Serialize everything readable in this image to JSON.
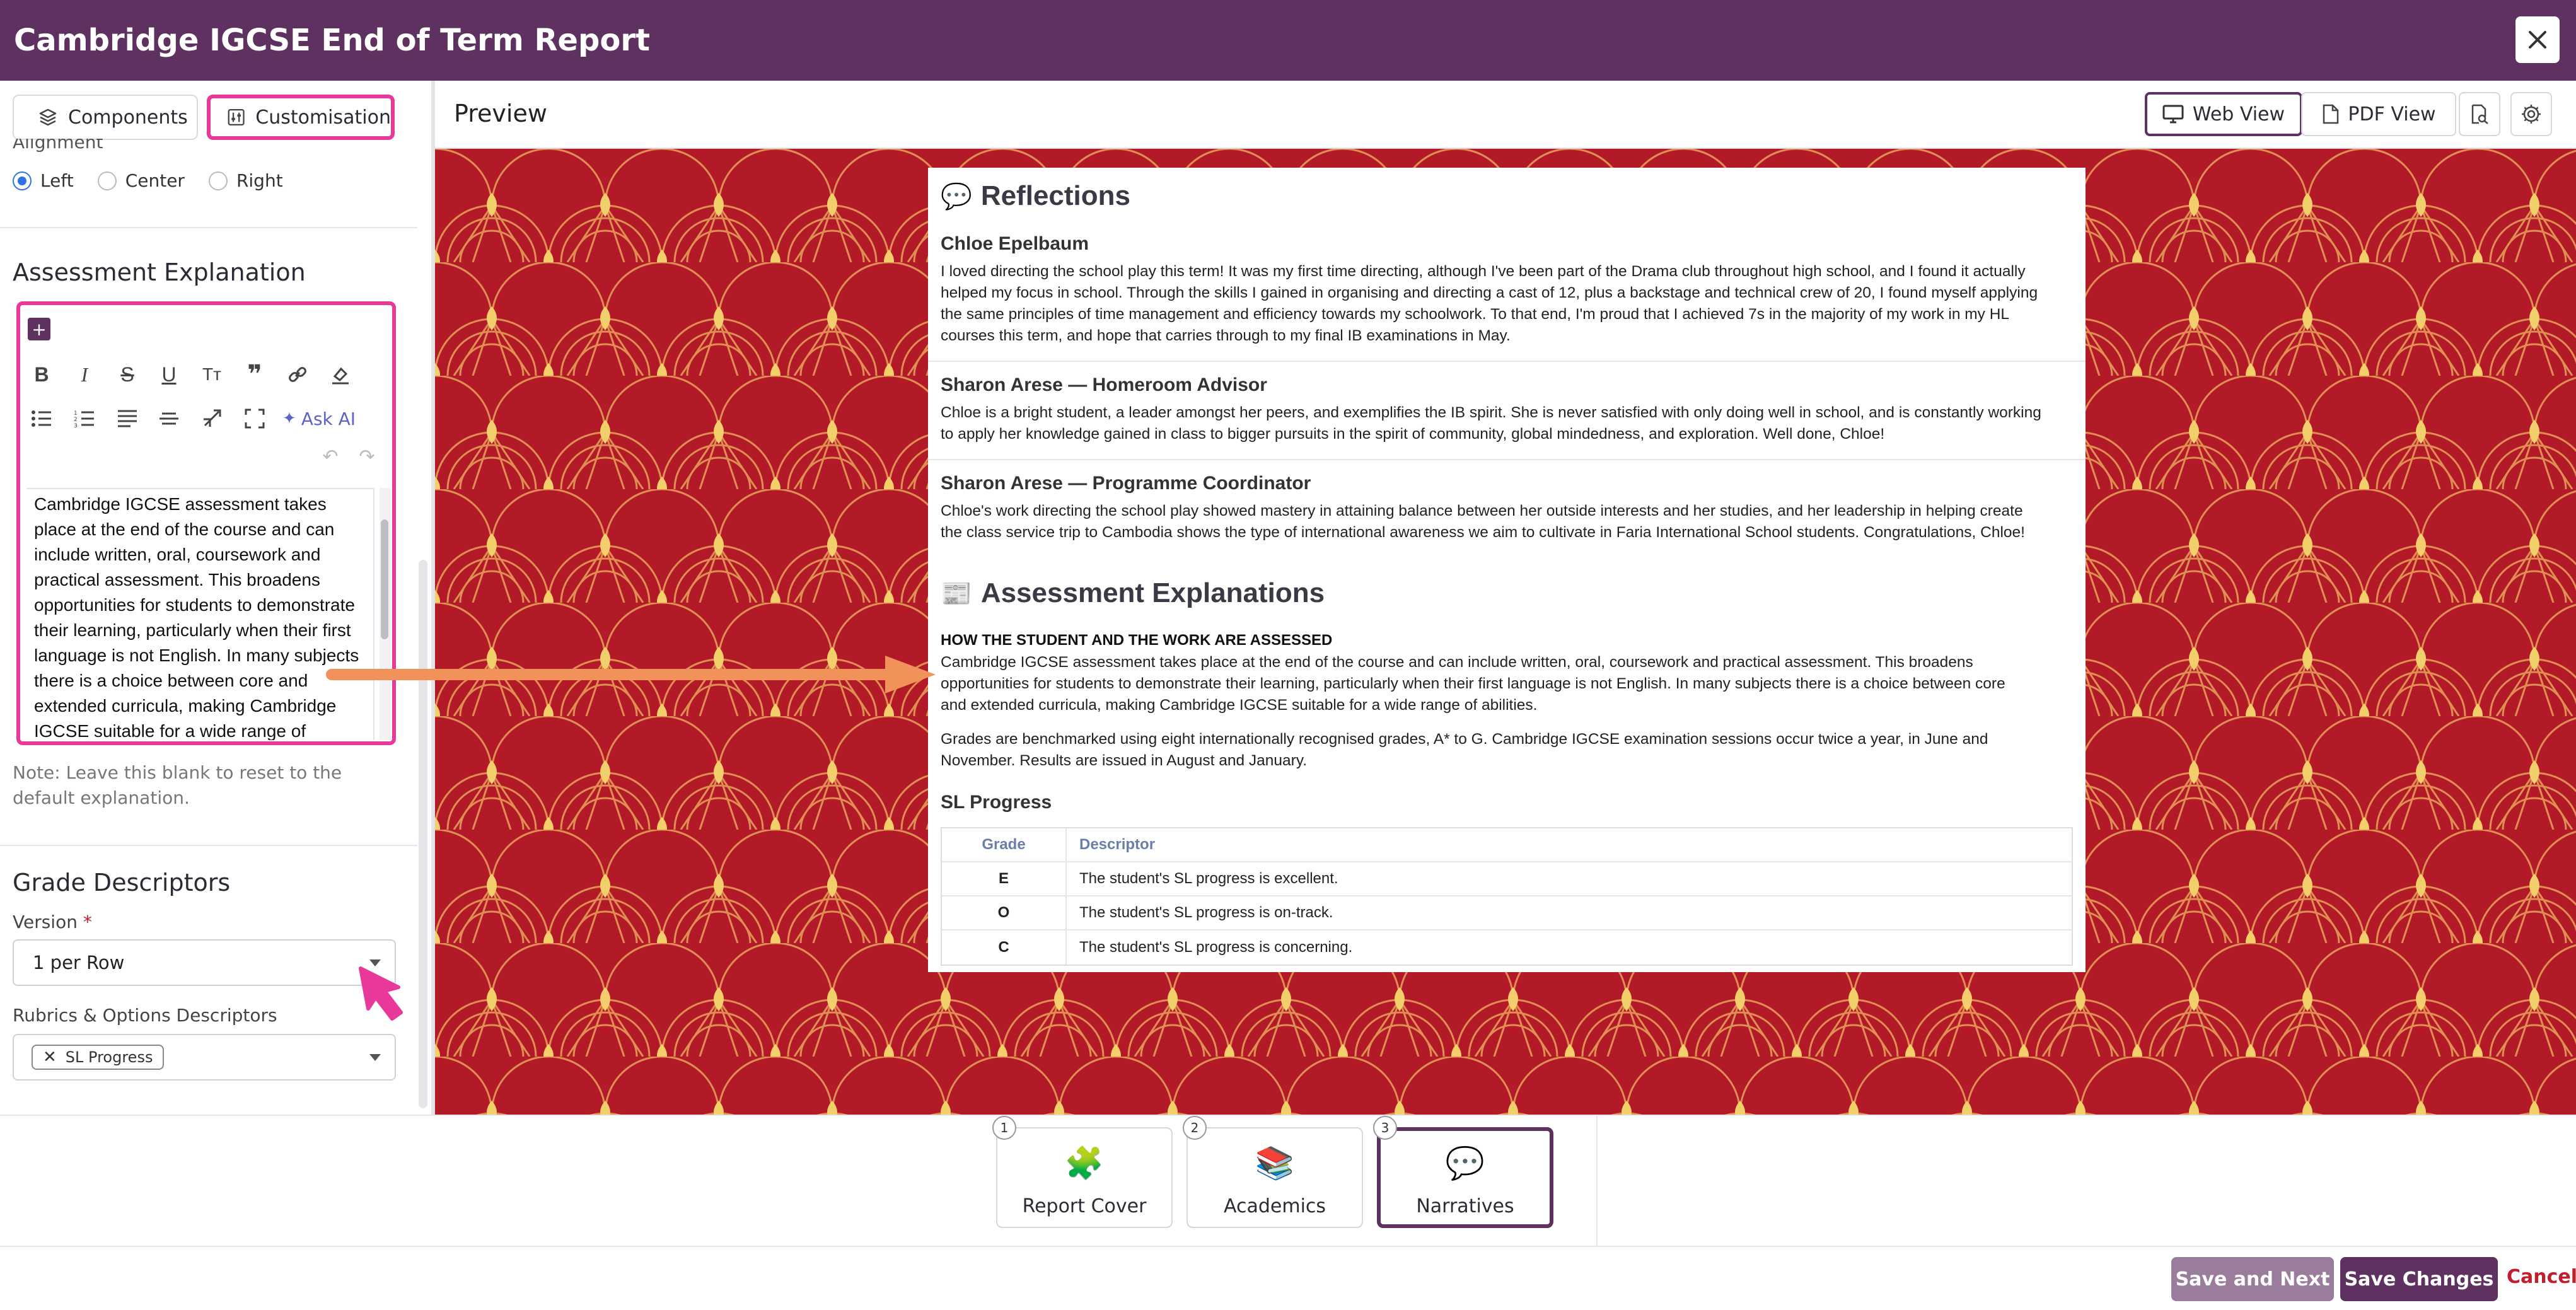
{
  "window": {
    "title": "Cambridge IGCSE End of Term Report"
  },
  "left_panel": {
    "tabs": [
      {
        "label": "Components",
        "icon": "layers-icon",
        "active": false
      },
      {
        "label": "Customisation",
        "icon": "sliders-icon",
        "active": true
      }
    ],
    "alignment": {
      "label": "Alignment",
      "options": [
        "Left",
        "Center",
        "Right"
      ],
      "selected": "Left"
    },
    "assessment_explanation": {
      "title": "Assessment Explanation",
      "ask_ai": "Ask AI",
      "text": "Cambridge IGCSE assessment takes place at the end of the course and can include written, oral, coursework and practical assessment. This broadens opportunities for students to demonstrate their learning, particularly when their first language is not English. In many subjects there is a choice between core and extended curricula, making Cambridge IGCSE suitable for a wide range of",
      "note": "Note: Leave this blank to reset to the default explanation."
    },
    "grade_descriptors": {
      "title": "Grade Descriptors",
      "version_label": "Version",
      "required_mark": "*",
      "version_value": "1 per Row",
      "rubrics_label": "Rubrics & Options Descriptors",
      "chips": [
        "SL Progress"
      ]
    }
  },
  "preview": {
    "title": "Preview",
    "web_view": "Web View",
    "pdf_view": "PDF View",
    "background_color": "#b21a28",
    "document": {
      "reflections_title": "Reflections",
      "reflections": [
        {
          "author": "Chloe Epelbaum",
          "lines": [
            "I loved directing the school play this term! It was my first time directing, although I've been part of the Drama club throughout high school, and I found it actually",
            "helped my focus in school. Through the skills I gained in organising and directing a cast of 12, plus a backstage and technical crew of 20, I found myself applying",
            "the same principles of time management and efficiency towards my schoolwork. To that end, I'm proud that I achieved 7s in the majority of my work in my HL",
            "courses this term, and hope that carries through to my final IB examinations in May."
          ]
        },
        {
          "author": "Sharon Arese — Homeroom Advisor",
          "lines": [
            "Chloe is a bright student, a leader amongst her peers, and exemplifies the IB spirit. She is never satisfied with only doing well in school, and is constantly working",
            "to apply her knowledge gained in class to bigger pursuits in the spirit of community, global mindedness, and exploration. Well done, Chloe!"
          ]
        },
        {
          "author": "Sharon Arese — Programme Coordinator",
          "lines": [
            "Chloe's work directing the school play showed mastery in attaining balance between her outside interests and her studies, and her leadership in helping create",
            "the class service trip to Cambodia shows the type of international awareness we aim to cultivate in Faria International School students. Congratulations, Chloe!"
          ]
        }
      ],
      "assessment_title": "Assessment Explanations",
      "assessment_subtitle": "HOW THE STUDENT AND THE WORK ARE ASSESSED",
      "assessment_lines": [
        "Cambridge IGCSE assessment takes place at the end of the course and can include written, oral, coursework and practical assessment. This broadens",
        "opportunities for students to demonstrate their learning, particularly when their first language is not English. In many subjects there is a choice between core",
        "and extended curricula, making Cambridge IGCSE suitable for a wide range of abilities."
      ],
      "grades_lines": [
        "Grades are benchmarked using eight internationally recognised grades, A* to G. Cambridge IGCSE examination sessions occur twice a year, in June and",
        "November. Results are issued in August and January."
      ],
      "sl_title": "SL Progress",
      "table": {
        "headers": [
          "Grade",
          "Descriptor"
        ],
        "rows": [
          [
            "E",
            "The student's SL progress is excellent."
          ],
          [
            "O",
            "The student's SL progress is on-track."
          ],
          [
            "C",
            "The student's SL progress is concerning."
          ]
        ]
      }
    }
  },
  "steps": [
    {
      "num": "1",
      "label": "Report Cover",
      "icon": "puzzle-icon"
    },
    {
      "num": "2",
      "label": "Academics",
      "icon": "books-icon"
    },
    {
      "num": "3",
      "label": "Narratives",
      "icon": "speech-bubble-icon",
      "active": true
    }
  ],
  "footer": {
    "save_next": "Save and Next",
    "save_changes": "Save Changes",
    "cancel": "Cancel"
  },
  "colors": {
    "header": "#5e3160",
    "highlight": "#e8399a",
    "arrow": "#f0925a",
    "cancel": "#c0202d"
  }
}
